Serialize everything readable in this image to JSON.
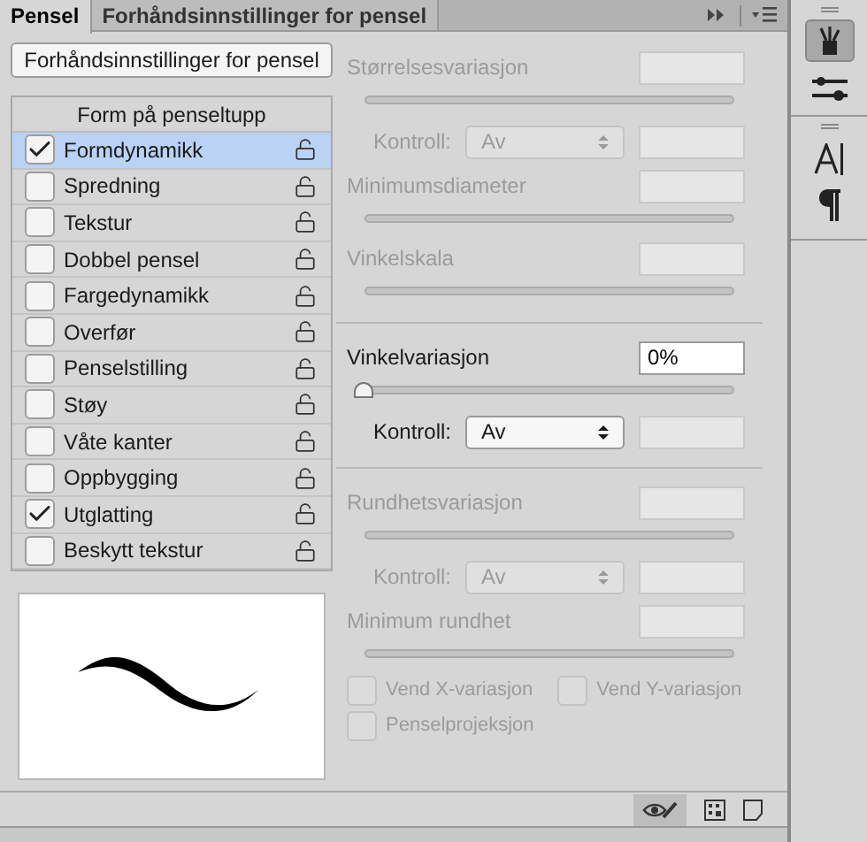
{
  "tabs": [
    {
      "label": "Pensel",
      "selected": true
    },
    {
      "label": "Forhåndsinnstillinger for pensel",
      "selected": false
    }
  ],
  "preset_button": "Forhåndsinnstillinger for pensel",
  "brush_list": {
    "header": "Form på penseltupp",
    "items": [
      {
        "label": "Formdynamikk",
        "checked": true,
        "selected": true
      },
      {
        "label": "Spredning",
        "checked": false,
        "selected": false
      },
      {
        "label": "Tekstur",
        "checked": false,
        "selected": false
      },
      {
        "label": "Dobbel pensel",
        "checked": false,
        "selected": false
      },
      {
        "label": "Fargedynamikk",
        "checked": false,
        "selected": false
      },
      {
        "label": "Overfør",
        "checked": false,
        "selected": false
      },
      {
        "label": "Penselstilling",
        "checked": false,
        "selected": false
      },
      {
        "label": "Støy",
        "checked": false,
        "selected": false
      },
      {
        "label": "Våte kanter",
        "checked": false,
        "selected": false
      },
      {
        "label": "Oppbygging",
        "checked": false,
        "selected": false
      },
      {
        "label": "Utglatting",
        "checked": true,
        "selected": false
      },
      {
        "label": "Beskytt tekstur",
        "checked": false,
        "selected": false
      }
    ]
  },
  "settings": [
    {
      "kind": "slider",
      "label": "Størrelsesvariasjon",
      "disabled": true
    },
    {
      "kind": "control",
      "label": "Kontroll:",
      "value": "Av",
      "disabled": true
    },
    {
      "kind": "slider",
      "label": "Minimumsdiameter",
      "disabled": true
    },
    {
      "kind": "slider",
      "label": "Vinkelskala",
      "disabled": true
    },
    {
      "kind": "divider"
    },
    {
      "kind": "slider",
      "label": "Vinkelvariasjon",
      "disabled": false,
      "value": "0%",
      "level": 0
    },
    {
      "kind": "control",
      "label": "Kontroll:",
      "value": "Av",
      "disabled": false
    },
    {
      "kind": "divider"
    },
    {
      "kind": "slider",
      "label": "Rundhetsvariasjon",
      "disabled": true
    },
    {
      "kind": "control",
      "label": "Kontroll:",
      "value": "Av",
      "disabled": true
    },
    {
      "kind": "slider",
      "label": "Minimum rundhet",
      "disabled": true
    },
    {
      "kind": "checkboxes",
      "items": [
        {
          "label": "Vend X-variasjon",
          "checked": false,
          "disabled": true
        },
        {
          "label": "Vend Y-variasjon",
          "checked": false,
          "disabled": true
        }
      ]
    },
    {
      "kind": "checkboxes",
      "items": [
        {
          "label": "Penselprojeksjon",
          "checked": false,
          "disabled": true
        }
      ]
    }
  ]
}
